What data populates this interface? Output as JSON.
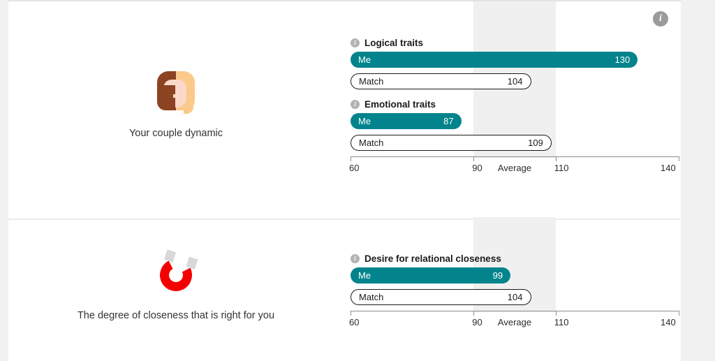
{
  "page": {
    "info_icon": "info-icon",
    "info_glyph": "i"
  },
  "colors": {
    "me_bar": "#03848c",
    "match_bar_outline": "#1a1a1a",
    "average_band": "#f0f0f0",
    "page_background": "#f1f1f1",
    "card_background": "#ffffff",
    "magnet_red": "#f40000"
  },
  "axis": {
    "min": 60,
    "max": 140,
    "ticks": [
      60,
      90,
      110,
      140
    ],
    "tick_labels": [
      "60",
      "90",
      "110",
      "140"
    ],
    "average_label": "Average",
    "average_range": [
      90,
      110
    ]
  },
  "sections": [
    {
      "id": "couple-dynamic",
      "icon": "couple-faces-icon",
      "caption": "Your couple dynamic",
      "traits": [
        {
          "title": "Logical traits",
          "info_icon": "info-icon",
          "bars": [
            {
              "label": "Me",
              "value": 130,
              "value_text": "130",
              "style": "me"
            },
            {
              "label": "Match",
              "value": 104,
              "value_text": "104",
              "style": "match"
            }
          ]
        },
        {
          "title": "Emotional traits",
          "info_icon": "info-icon",
          "bars": [
            {
              "label": "Me",
              "value": 87,
              "value_text": "87",
              "style": "me"
            },
            {
              "label": "Match",
              "value": 109,
              "value_text": "109",
              "style": "match"
            }
          ]
        }
      ]
    },
    {
      "id": "relational-closeness",
      "icon": "magnet-icon",
      "caption": "The degree of closeness that is right for you",
      "traits": [
        {
          "title": "Desire for relational closeness",
          "info_icon": "info-icon",
          "bars": [
            {
              "label": "Me",
              "value": 99,
              "value_text": "99",
              "style": "me"
            },
            {
              "label": "Match",
              "value": 104,
              "value_text": "104",
              "style": "match"
            }
          ]
        }
      ]
    }
  ],
  "chart_data": {
    "type": "bar",
    "title": "",
    "xlabel": "",
    "ylabel": "",
    "xlim": [
      60,
      140
    ],
    "grid": false,
    "orientation": "horizontal",
    "legend": [
      "Me",
      "Match"
    ],
    "annotations": [
      "Average band spans 90 to 110"
    ],
    "groups": [
      {
        "category": "Logical traits",
        "section": "Your couple dynamic",
        "series": [
          {
            "name": "Me",
            "value": 130
          },
          {
            "name": "Match",
            "value": 104
          }
        ]
      },
      {
        "category": "Emotional traits",
        "section": "Your couple dynamic",
        "series": [
          {
            "name": "Me",
            "value": 87
          },
          {
            "name": "Match",
            "value": 109
          }
        ]
      },
      {
        "category": "Desire for relational closeness",
        "section": "The degree of closeness that is right for you",
        "series": [
          {
            "name": "Me",
            "value": 99
          },
          {
            "name": "Match",
            "value": 104
          }
        ]
      }
    ]
  }
}
